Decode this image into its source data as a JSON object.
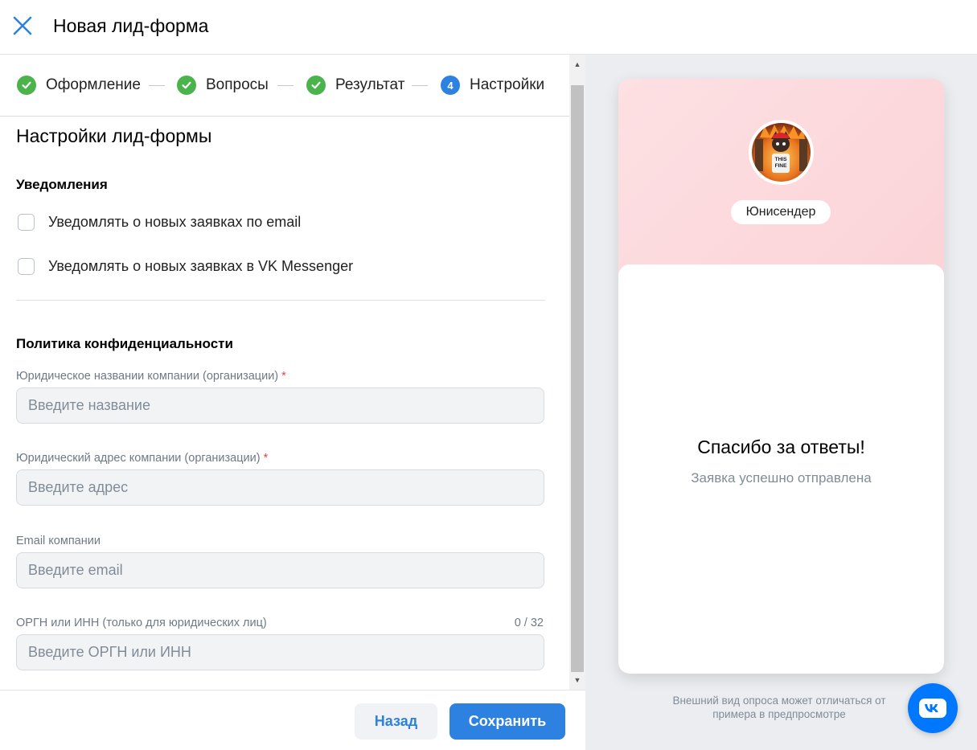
{
  "header": {
    "title": "Новая лид-форма",
    "close_icon": "close-icon"
  },
  "steps": [
    {
      "label": "Оформление",
      "state": "done"
    },
    {
      "label": "Вопросы",
      "state": "done"
    },
    {
      "label": "Результат",
      "state": "done"
    },
    {
      "label": "Настройки",
      "state": "current",
      "number": "4"
    }
  ],
  "settings": {
    "title": "Настройки лид-формы",
    "notifications": {
      "heading": "Уведомления",
      "options": [
        {
          "label": "Уведомлять о новых заявках по email",
          "checked": false
        },
        {
          "label": "Уведомлять о новых заявках в VK Messenger",
          "checked": false
        }
      ]
    },
    "privacy": {
      "heading": "Политика конфиденциальности",
      "fields": [
        {
          "label": "Юридическое названии компании (организации)",
          "required": "*",
          "placeholder": "Введите название",
          "value": ""
        },
        {
          "label": "Юридический адрес компании (организации)",
          "required": "*",
          "placeholder": "Введите адрес",
          "value": ""
        },
        {
          "label": "Email компании",
          "placeholder": "Введите email",
          "value": ""
        },
        {
          "label": "ОРГН или ИНН (только для юридических лиц)",
          "counter": "0 / 32",
          "placeholder": "Введите ОРГН или ИНН",
          "value": ""
        }
      ]
    }
  },
  "footer": {
    "back_label": "Назад",
    "save_label": "Сохранить"
  },
  "preview": {
    "org_name": "Юнисендер",
    "thanks_title": "Спасибо за ответы!",
    "thanks_subtitle": "Заявка успешно отправлена",
    "note": "Внешний вид опроса может отличаться от примера в предпросмотре",
    "avatar_image_text": "THIS FINE"
  },
  "colors": {
    "accent": "#2d81e0",
    "done_green": "#4bb34b",
    "vk_blue": "#0077ff",
    "preview_header": "#fad0d5",
    "required": "#e64646"
  }
}
